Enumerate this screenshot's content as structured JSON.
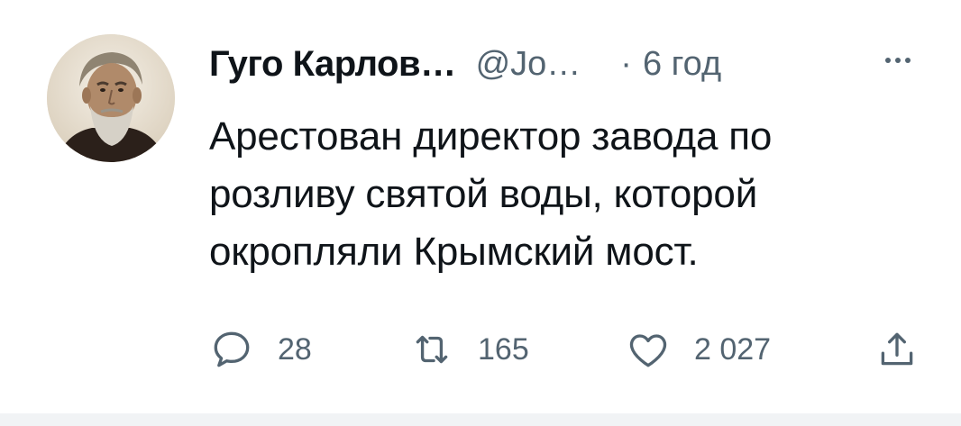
{
  "tweet": {
    "author": {
      "display_name": "Гуго Карлов…",
      "handle": "@Jo…",
      "avatar_icon": "avatar-portrait-icon"
    },
    "separator": "·",
    "time": "6 год",
    "more_icon": "more-horizontal-icon",
    "text": "Арестован директор завода по розливу святой воды, которой окропляли Крымский мост.",
    "actions": {
      "reply_count": "28",
      "retweet_count": "165",
      "like_count": "2 027"
    }
  },
  "colors": {
    "text_primary": "#0f1419",
    "text_secondary": "#536471",
    "background": "#ffffff",
    "divider": "#f1f3f5"
  }
}
